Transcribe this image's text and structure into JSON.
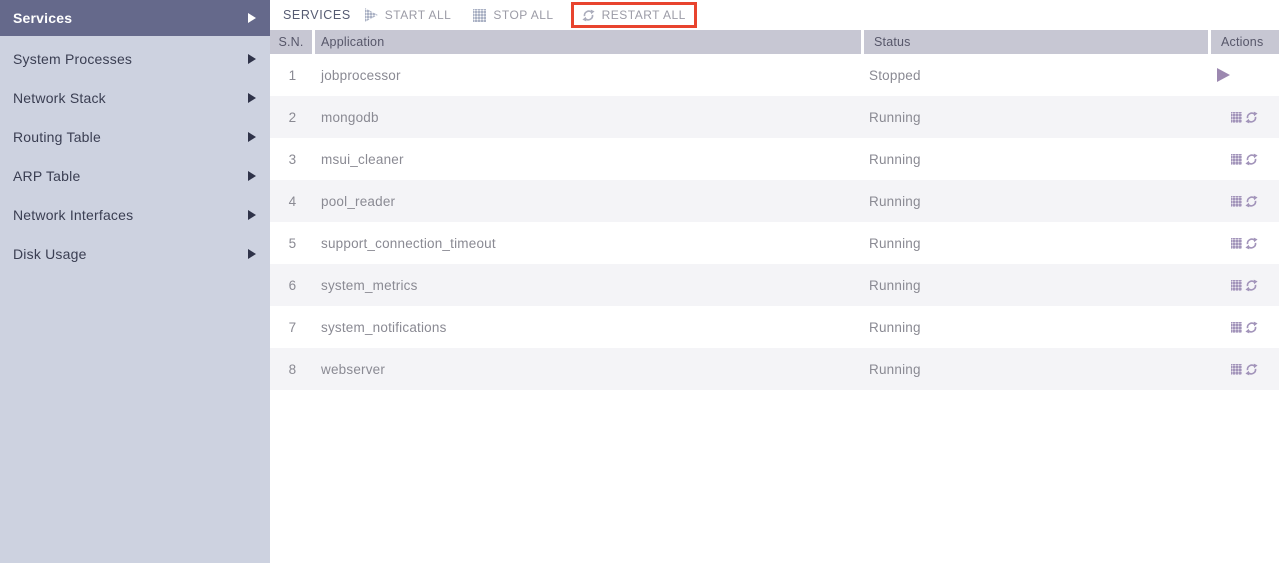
{
  "sidebar": {
    "items": [
      {
        "label": "Services",
        "selected": true
      },
      {
        "label": "System Processes",
        "selected": false
      },
      {
        "label": "Network Stack",
        "selected": false
      },
      {
        "label": "Routing Table",
        "selected": false
      },
      {
        "label": "ARP Table",
        "selected": false
      },
      {
        "label": "Network Interfaces",
        "selected": false
      },
      {
        "label": "Disk Usage",
        "selected": false
      }
    ]
  },
  "toolbar": {
    "title": "SERVICES",
    "buttons": [
      {
        "label": "START ALL",
        "icon": "play-icon",
        "highlighted": false
      },
      {
        "label": "STOP ALL",
        "icon": "stop-icon",
        "highlighted": false
      },
      {
        "label": "RESTART ALL",
        "icon": "restart-icon",
        "highlighted": true
      }
    ],
    "highlight_note": "red annotation box around RESTART ALL"
  },
  "table": {
    "columns": [
      "S.N.",
      "Application",
      "Status",
      "Actions"
    ],
    "rows": [
      {
        "sn": "1",
        "application": "jobprocessor",
        "status": "Stopped",
        "actions": [
          "start"
        ]
      },
      {
        "sn": "2",
        "application": "mongodb",
        "status": "Running",
        "actions": [
          "stop",
          "restart"
        ]
      },
      {
        "sn": "3",
        "application": "msui_cleaner",
        "status": "Running",
        "actions": [
          "stop",
          "restart"
        ]
      },
      {
        "sn": "4",
        "application": "pool_reader",
        "status": "Running",
        "actions": [
          "stop",
          "restart"
        ]
      },
      {
        "sn": "5",
        "application": "support_connection_timeout",
        "status": "Running",
        "actions": [
          "stop",
          "restart"
        ]
      },
      {
        "sn": "6",
        "application": "system_metrics",
        "status": "Running",
        "actions": [
          "stop",
          "restart"
        ]
      },
      {
        "sn": "7",
        "application": "system_notifications",
        "status": "Running",
        "actions": [
          "stop",
          "restart"
        ]
      },
      {
        "sn": "8",
        "application": "webserver",
        "status": "Running",
        "actions": [
          "stop",
          "restart"
        ]
      }
    ]
  },
  "colors": {
    "sidebar_bg": "#cdd2e0",
    "sidebar_selected_bg": "#65698b",
    "sidebar_text": "#3a3e52",
    "header_bg": "#c7c7d3",
    "header_text": "#57576a",
    "row_alt_bg": "#f4f4f7",
    "row_text": "#8a8a93",
    "toolbar_text": "#9b9ba6",
    "toolbar_title_text": "#565b72",
    "action_icon_purple": "#a294ba",
    "play_icon_purple": "#9c88b0",
    "highlight_red": "#e8442e"
  }
}
